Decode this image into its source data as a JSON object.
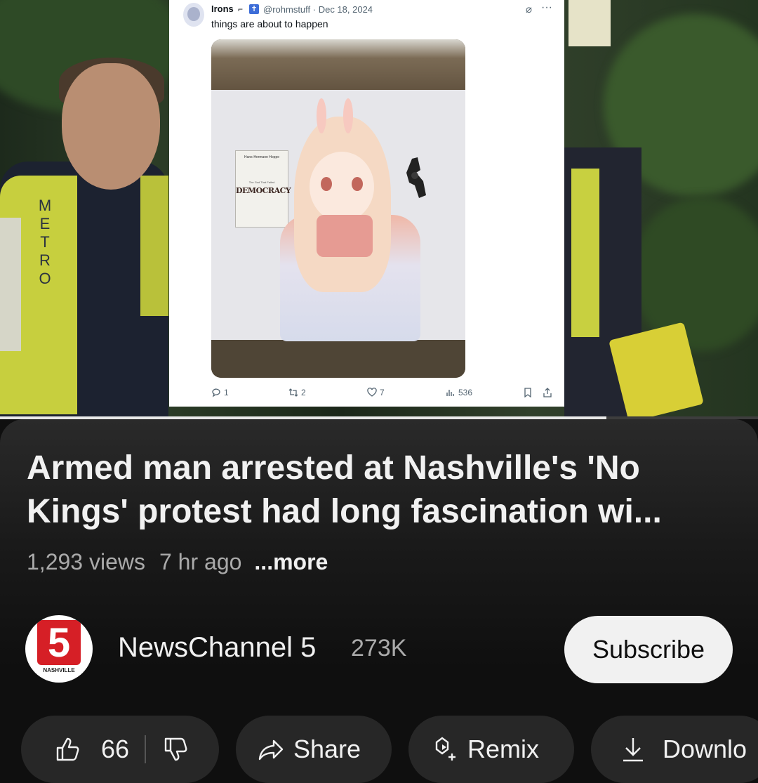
{
  "tweet": {
    "name": "Irons",
    "handle_date": "@rohmstuff · Dec 18, 2024",
    "text": "things are about to happen",
    "book_top": "Hans-Hermann Hoppe",
    "book_title": "DEMOCRACY",
    "book_subtitle": "The God That Failed",
    "replies": "1",
    "reposts": "2",
    "likes": "7",
    "views": "536"
  },
  "video": {
    "progress_fraction": 0.8,
    "title": "Armed man arrested at Nashville's 'No Kings' protest had long fascination wi...",
    "views": "1,293 views",
    "age": "7 hr ago",
    "more_label": "...more"
  },
  "channel": {
    "logo_number": "5",
    "logo_text": "NASHVILLE",
    "name": "NewsChannel 5",
    "subscribers": "273K",
    "subscribe_label": "Subscribe"
  },
  "actions": {
    "like_count": "66",
    "share_label": "Share",
    "remix_label": "Remix",
    "download_label": "Downlo"
  },
  "background_sign": {
    "metro_vest_text": "METRO"
  }
}
